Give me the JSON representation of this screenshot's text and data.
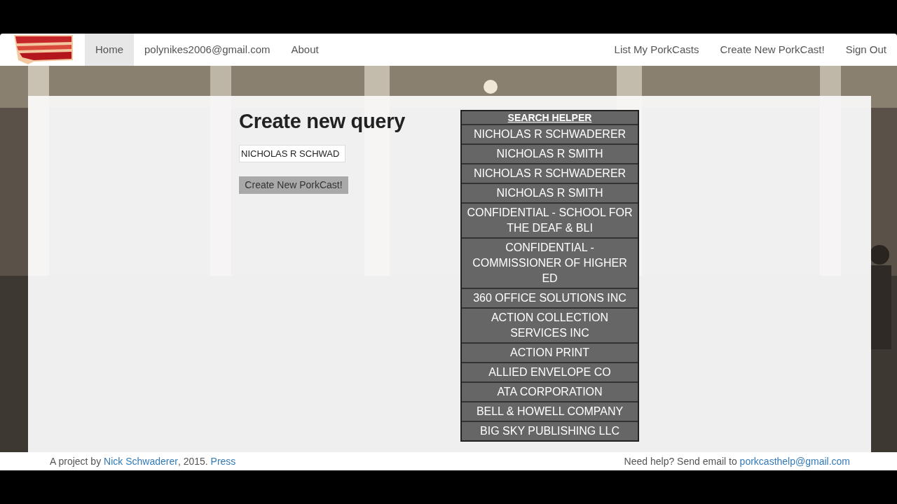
{
  "navbar": {
    "left": [
      {
        "label": "Home",
        "selected": true
      },
      {
        "label": "polynikes2006@gmail.com",
        "selected": false
      },
      {
        "label": "About",
        "selected": false
      }
    ],
    "right": [
      {
        "label": "List My PorkCasts"
      },
      {
        "label": "Create New PorkCast!"
      },
      {
        "label": "Sign Out"
      }
    ]
  },
  "heading": "Create new query",
  "query_field": {
    "value": "NICHOLAS R SCHWAD"
  },
  "submit_button": "Create New PorkCast!",
  "search_helper": {
    "title": "SEARCH HELPER",
    "items": [
      "NICHOLAS R SCHWADERER",
      "NICHOLAS R SMITH",
      "NICHOLAS R SCHWADERER",
      "NICHOLAS R SMITH",
      "CONFIDENTIAL - SCHOOL FOR THE DEAF & BLI",
      "CONFIDENTIAL - COMMISSIONER OF HIGHER ED",
      "360 OFFICE SOLUTIONS INC",
      "ACTION COLLECTION SERVICES INC",
      "ACTION PRINT",
      "ALLIED ENVELOPE CO",
      "ATA CORPORATION",
      "BELL & HOWELL COMPANY",
      "BIG SKY PUBLISHING LLC"
    ]
  },
  "footer": {
    "left": [
      {
        "kind": "text",
        "text": "A project by "
      },
      {
        "kind": "link",
        "text": "Nick Schwaderer"
      },
      {
        "kind": "text",
        "text": ", 2015. "
      },
      {
        "kind": "link",
        "text": "Press"
      }
    ],
    "right": [
      {
        "kind": "text",
        "text": "Need help? Send email to "
      },
      {
        "kind": "link",
        "text": "porkcasthelp@gmail.com"
      }
    ]
  }
}
